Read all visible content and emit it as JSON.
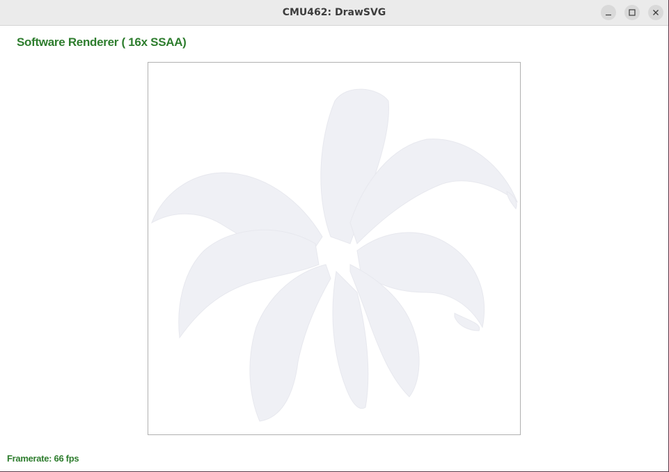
{
  "window": {
    "title": "CMU462: DrawSVG",
    "controls": {
      "minimize_icon": "minimize-icon",
      "maximize_icon": "maximize-icon",
      "close_icon": "close-icon"
    }
  },
  "hud": {
    "renderer_label": "Software Renderer ( 16x SSAA)",
    "framerate_label": "Framerate: 66 fps"
  },
  "canvas": {
    "subject": "faint plant-leaves drawing",
    "fill_color": "#eeeff4",
    "border_color": "#b0b0b0"
  },
  "colors": {
    "hud_text": "#2e7d2e",
    "titlebar": "#ebebeb",
    "background": "#ffffff"
  }
}
